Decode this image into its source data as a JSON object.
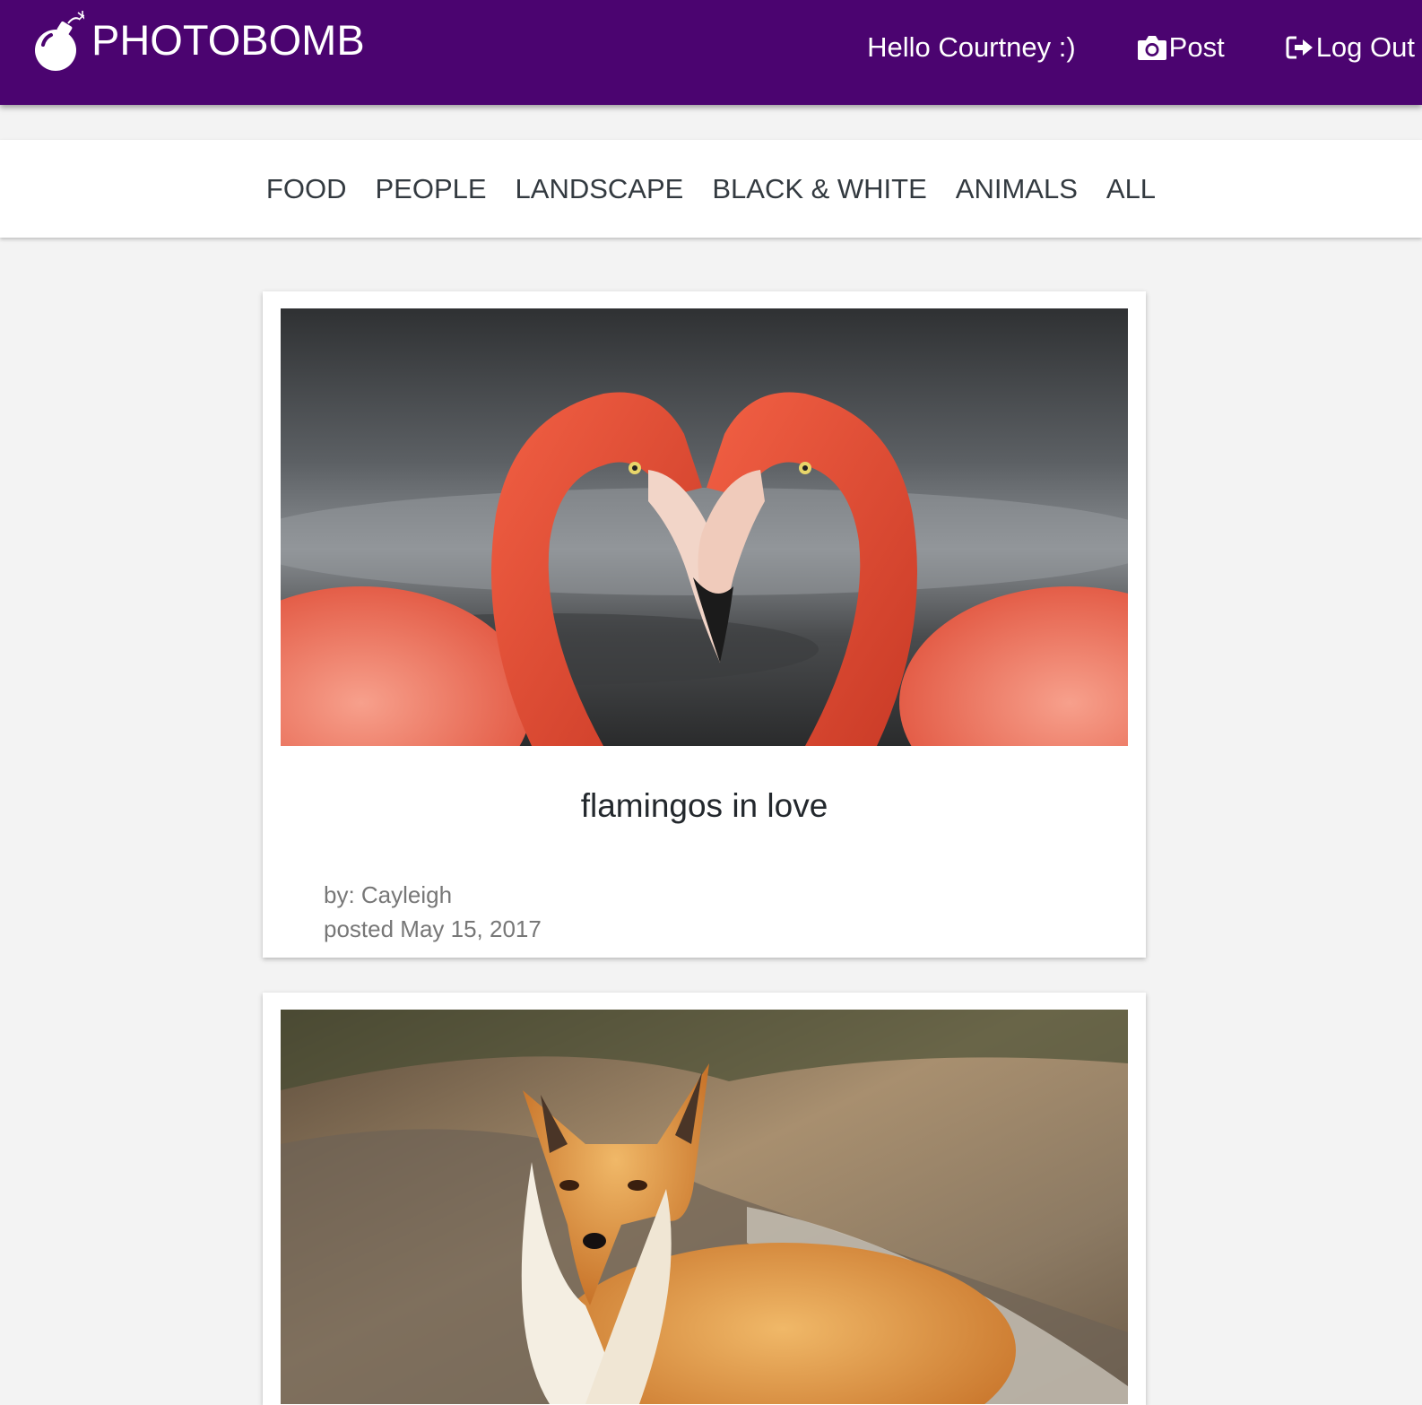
{
  "header": {
    "brand": "PHOTOBOMB",
    "logo_icon": "bomb-icon",
    "greeting": "Hello Courtney :)",
    "post_label": "Post",
    "post_icon": "camera-icon",
    "logout_label": "Log Out",
    "logout_icon": "sign-out-icon",
    "bg_color": "#4b0470"
  },
  "categories": [
    "FOOD",
    "PEOPLE",
    "LANDSCAPE",
    "BLACK & WHITE",
    "ANIMALS",
    "ALL"
  ],
  "posts": [
    {
      "title": "flamingos in love",
      "author": "by: Cayleigh",
      "date": "posted May 15, 2017",
      "image": "photo of two flamingos forming a heart"
    },
    {
      "image": "photo of a red fox sitting"
    }
  ]
}
